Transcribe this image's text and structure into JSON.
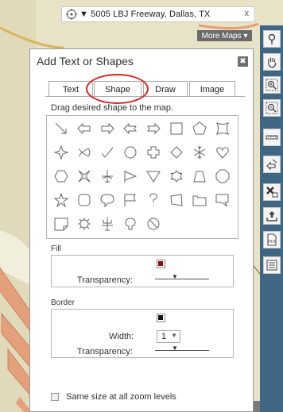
{
  "address_bar": {
    "text": "▼ 5005 LBJ Freeway, Dallas, TX",
    "close": "x"
  },
  "more_maps": {
    "label": "More Maps ▾"
  },
  "panel": {
    "title": "Add Text or Shapes",
    "close": "✖",
    "tabs": [
      {
        "label": "Text"
      },
      {
        "label": "Shape"
      },
      {
        "label": "Draw"
      },
      {
        "label": "Image"
      }
    ],
    "active_tab": "Shape",
    "instruction": "Drag desired shape to the map.",
    "shapes": [
      "diagonal-arrow-icon",
      "left-arrow-icon",
      "right-arrow-icon",
      "left-notched-arrow-icon",
      "right-notched-arrow-icon",
      "square-icon",
      "pentagon-icon",
      "concave-square-icon",
      "four-point-star-icon",
      "fish-arrow-icon",
      "checkmark-icon",
      "circle-icon",
      "plus-icon",
      "diamond-icon",
      "snowflake-icon",
      "heart-icon",
      "hexagon-icon",
      "x-cross-icon",
      "airplane-icon",
      "pennant-icon",
      "triangle-down-icon",
      "scalloped-star-icon",
      "trapezoid-icon",
      "octagon-icon",
      "star-icon",
      "rounded-square-icon",
      "speech-bubble-icon",
      "flag-icon",
      "question-icon",
      "skewed-square-icon",
      "folder-icon",
      "callout-icon",
      "note-icon",
      "gear-icon",
      "cactus-icon",
      "bulb-shape-icon",
      "no-symbol-icon"
    ],
    "fill": {
      "label": "Fill",
      "color": "#8a0e0e",
      "transparency_label": "Transparency:",
      "transparency": 0.5
    },
    "border": {
      "label": "Border",
      "color": "#111111",
      "width_label": "Width:",
      "width_value": "1",
      "transparency_label": "Transparency:",
      "transparency": 0.5
    },
    "same_size": {
      "label": "Same size at all zoom levels",
      "checked": false
    }
  },
  "toolbar_icons": [
    "pin-icon",
    "hand-icon",
    "zoom-in-icon",
    "zoom-out-icon",
    "scale-bar-icon",
    "shapes-tool-icon",
    "clear-icon",
    "share-icon",
    "pdf-icon",
    "list-icon"
  ],
  "colors": {
    "toolbar": "#3f6783",
    "map_bg": "#e8e2c6",
    "road": "#e3a07a",
    "highlight": "#e02020"
  }
}
